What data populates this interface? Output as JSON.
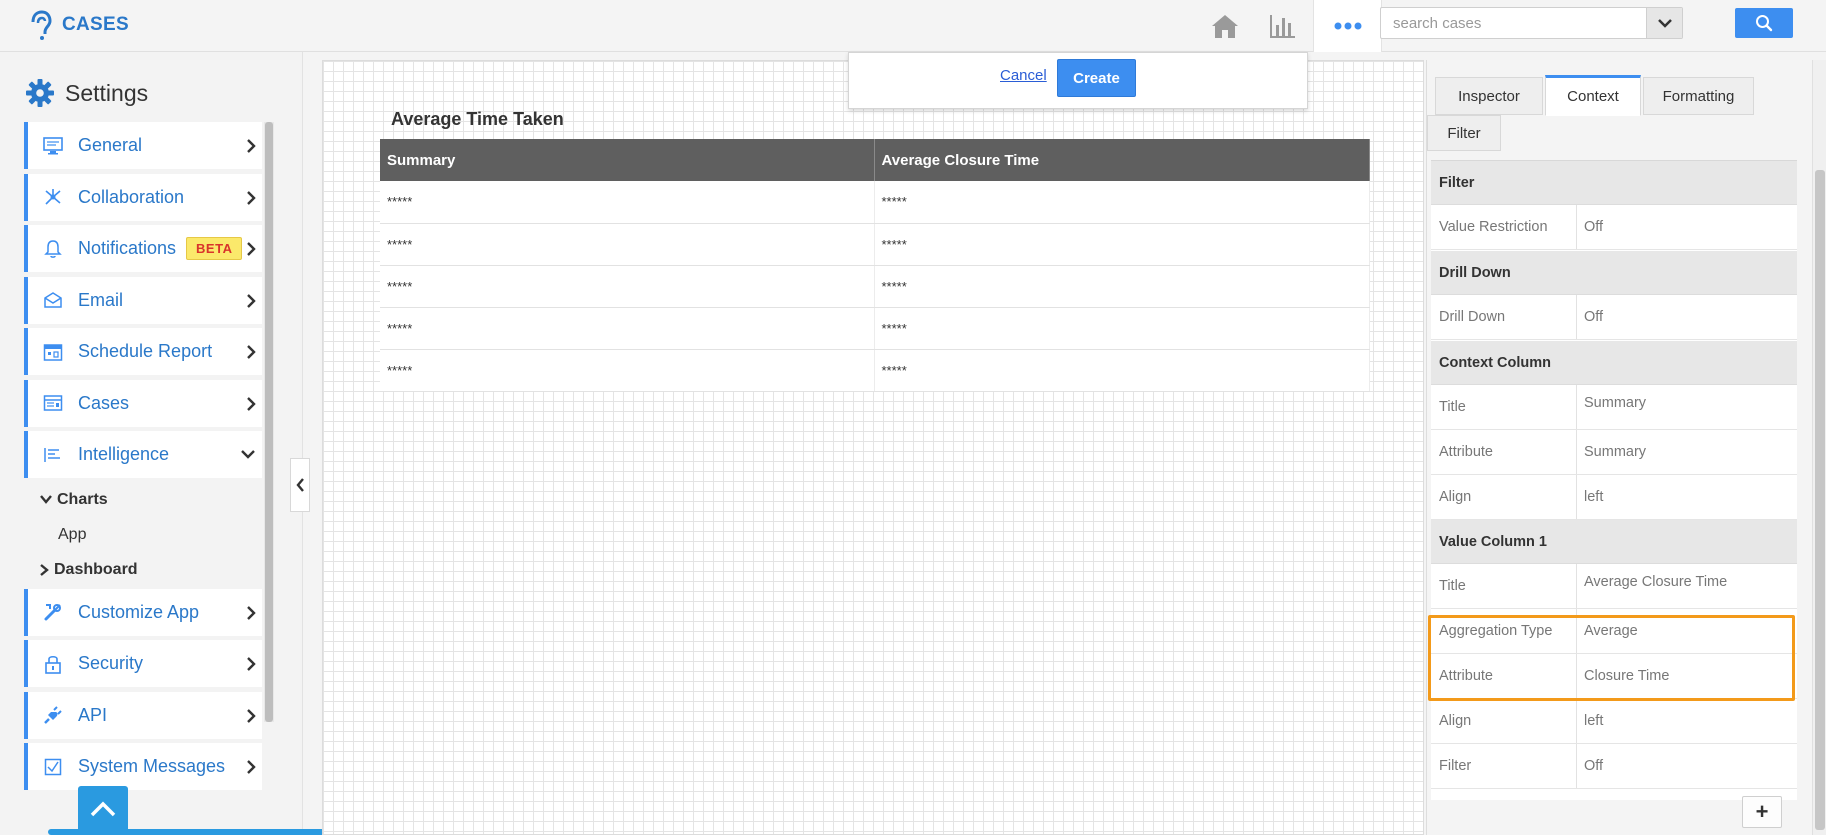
{
  "app": {
    "title": "CASES",
    "brand_color": "#2a78c9",
    "accent_color": "#3d8ef0",
    "highlight_color": "#f39a1a"
  },
  "header": {
    "icons": [
      "home-icon",
      "bar-chart-icon",
      "more-options-icon"
    ],
    "search": {
      "placeholder": "search cases",
      "value": ""
    }
  },
  "sidebar": {
    "title": "Settings",
    "items": [
      {
        "label": "General",
        "icon": "monitor-icon",
        "expanded": false
      },
      {
        "label": "Collaboration",
        "icon": "collaboration-icon",
        "expanded": false
      },
      {
        "label": "Notifications",
        "icon": "bell-icon",
        "badge": "BETA",
        "expanded": false
      },
      {
        "label": "Email",
        "icon": "envelope-icon",
        "expanded": false
      },
      {
        "label": "Schedule Report",
        "icon": "calendar-icon",
        "expanded": false
      },
      {
        "label": "Cases",
        "icon": "cases-icon",
        "expanded": false
      },
      {
        "label": "Intelligence",
        "icon": "intelligence-icon",
        "expanded": true
      },
      {
        "label": "Customize App",
        "icon": "tools-icon",
        "expanded": false
      },
      {
        "label": "Security",
        "icon": "lock-icon",
        "expanded": false
      },
      {
        "label": "API",
        "icon": "plug-icon",
        "expanded": false
      },
      {
        "label": "System Messages",
        "icon": "checkbox-icon",
        "expanded": false
      }
    ],
    "intelligence_sub": {
      "charts": "Charts",
      "app": "App",
      "dashboard": "Dashboard"
    }
  },
  "popover": {
    "cancel": "Cancel",
    "create": "Create"
  },
  "widget": {
    "title": "Average Time Taken",
    "columns": [
      "Summary",
      "Average Closure Time"
    ],
    "rows": [
      [
        "*****",
        "*****"
      ],
      [
        "*****",
        "*****"
      ],
      [
        "*****",
        "*****"
      ],
      [
        "*****",
        "*****"
      ],
      [
        "*****",
        "*****"
      ]
    ]
  },
  "inspector": {
    "tabs": [
      "Inspector",
      "Context",
      "Formatting",
      "Filter"
    ],
    "active_tab": "Context",
    "sections": {
      "filter": {
        "title": "Filter",
        "rows": [
          {
            "label": "Value Restriction",
            "value": "Off"
          }
        ]
      },
      "drill_down": {
        "title": "Drill Down",
        "rows": [
          {
            "label": "Drill Down",
            "value": "Off"
          }
        ]
      },
      "context_column": {
        "title": "Context Column",
        "rows": [
          {
            "label": "Title",
            "value": "Summary"
          },
          {
            "label": "Attribute",
            "value": "Summary"
          },
          {
            "label": "Align",
            "value": "left"
          }
        ]
      },
      "value_column_1": {
        "title": "Value Column 1",
        "rows": [
          {
            "label": "Title",
            "value": "Average Closure Time"
          },
          {
            "label": "Aggregation Type",
            "value": "Average"
          },
          {
            "label": "Attribute",
            "value": "Closure Time"
          },
          {
            "label": "Align",
            "value": "left"
          },
          {
            "label": "Filter",
            "value": "Off"
          }
        ]
      }
    },
    "add_button": "+"
  }
}
